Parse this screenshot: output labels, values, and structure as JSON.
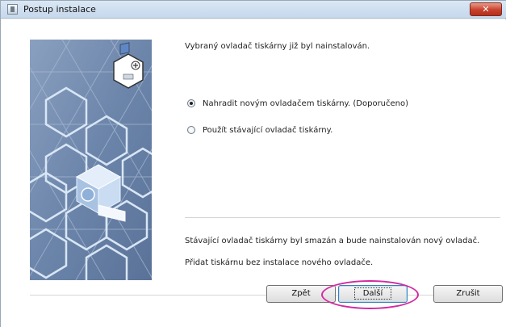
{
  "window": {
    "title": "Postup instalace",
    "close_label": "✕",
    "accent_colors": {
      "titlebar": "#c6d8ec",
      "close": "#c8412c",
      "highlight_ring": "#d32aa0",
      "art_background": "#6f87ab"
    }
  },
  "main": {
    "heading": "Vybraný ovladač tiskárny již byl nainstalován.",
    "options": [
      {
        "label": "Nahradit novým ovladačem tiskárny. (Doporučeno)",
        "checked": true
      },
      {
        "label": "Použít stávající ovladač tiskárny.",
        "checked": false
      }
    ],
    "notes": [
      "Stávající ovladač tiskárny byl smazán a bude nainstalován nový ovladač.",
      "Přidat tiskárnu bez instalace nového ovladače."
    ]
  },
  "buttons": {
    "back": "Zpět",
    "next": "Další",
    "cancel": "Zrušit"
  }
}
